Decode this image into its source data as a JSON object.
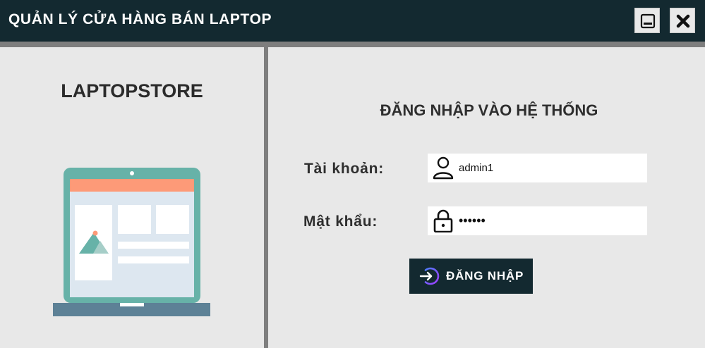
{
  "window": {
    "title": "QUẢN LÝ CỬA HÀNG BÁN LAPTOP",
    "minimize_icon": "minimize-icon",
    "close_icon": "close-icon"
  },
  "left_panel": {
    "brand": "LAPTOPSTORE",
    "illustration": "laptop-illustration"
  },
  "login": {
    "heading": "ĐĂNG NHẬP VÀO HỆ THỐNG",
    "username_label": "Tài khoản:",
    "username_value": "admin1",
    "username_icon": "user-icon",
    "password_label": "Mật khẩu:",
    "password_value": "••••••",
    "password_icon": "lock-icon",
    "button_label": "ĐĂNG NHẬP",
    "button_icon": "login-arrow-icon"
  },
  "colors": {
    "titlebar": "#132930",
    "background": "#e8e8e8",
    "divider": "#7e7e7e",
    "button": "#132930",
    "laptop_frame": "#67b2a8",
    "laptop_header": "#fd9a78",
    "laptop_base": "#5d8196"
  }
}
